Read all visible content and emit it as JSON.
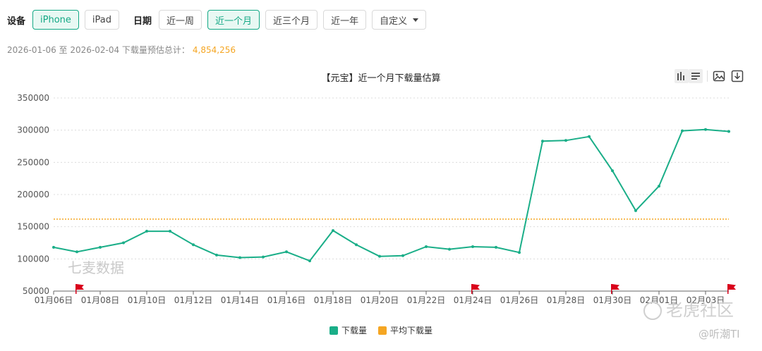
{
  "filters": {
    "device_label": "设备",
    "devices": [
      {
        "label": "iPhone",
        "active": true
      },
      {
        "label": "iPad",
        "active": false
      }
    ],
    "date_label": "日期",
    "dates": [
      {
        "label": "近一周",
        "active": false
      },
      {
        "label": "近一个月",
        "active": true
      },
      {
        "label": "近三个月",
        "active": false
      },
      {
        "label": "近一年",
        "active": false
      },
      {
        "label": "自定义",
        "active": false
      }
    ]
  },
  "summary": {
    "text": "2026-01-06 至 2026-02-04 下载量预估总计：",
    "total": "4,854,256"
  },
  "toolbox": {
    "icons": [
      "bar-line-toggle-icon",
      "list-toggle-icon",
      "save-image-icon",
      "download-icon"
    ]
  },
  "watermarks": {
    "left": "七麦数据",
    "bottom_right": "老虎社区",
    "corner": "@听潮TI"
  },
  "colors": {
    "series": "#1aae88",
    "average": "#f5a623",
    "accent": "#13a885",
    "flag": "#d9001b"
  },
  "chart_data": {
    "type": "line",
    "title": "【元宝】近一个月下载量估算",
    "x": [
      "01月06日",
      "01月07日",
      "01月08日",
      "01月09日",
      "01月10日",
      "01月11日",
      "01月12日",
      "01月13日",
      "01月14日",
      "01月15日",
      "01月16日",
      "01月17日",
      "01月18日",
      "01月19日",
      "01月20日",
      "01月21日",
      "01月22日",
      "01月23日",
      "01月24日",
      "01月25日",
      "01月26日",
      "01月27日",
      "01月28日",
      "01月29日",
      "01月30日",
      "01月31日",
      "02月01日",
      "02月02日",
      "02月03日",
      "02月04日"
    ],
    "x_tick_labels": [
      "01月06日",
      "01月08日",
      "01月10日",
      "01月12日",
      "01月14日",
      "01月16日",
      "01月18日",
      "01月20日",
      "01月22日",
      "01月24日",
      "01月26日",
      "01月28日",
      "01月30日",
      "02月01日",
      "02月03日"
    ],
    "series": [
      {
        "name": "下载量",
        "values": [
          118000,
          111000,
          118000,
          125000,
          143000,
          143000,
          122000,
          106000,
          102000,
          103000,
          111000,
          97000,
          144000,
          122000,
          104000,
          105000,
          119000,
          115000,
          119000,
          118000,
          110000,
          283000,
          284000,
          290000,
          237000,
          175000,
          213000,
          299000,
          301000,
          298000
        ]
      },
      {
        "name": "平均下载量",
        "values": [
          161800,
          161800,
          161800,
          161800,
          161800,
          161800,
          161800,
          161800,
          161800,
          161800,
          161800,
          161800,
          161800,
          161800,
          161800,
          161800,
          161800,
          161800,
          161800,
          161800,
          161800,
          161800,
          161800,
          161800,
          161800,
          161800,
          161800,
          161800,
          161800,
          161800
        ]
      }
    ],
    "flags": [
      "01月07日",
      "01月24日",
      "01月30日",
      "02月04日"
    ],
    "ylim": [
      50000,
      350000
    ],
    "yticks": [
      50000,
      100000,
      150000,
      200000,
      250000,
      300000,
      350000
    ],
    "grid": true,
    "legend": "bottom-center",
    "xlabel": "",
    "ylabel": ""
  }
}
